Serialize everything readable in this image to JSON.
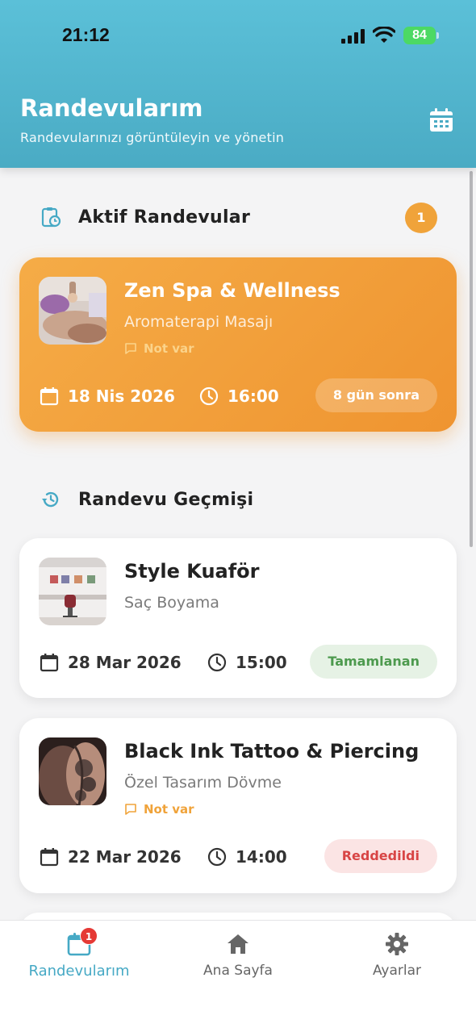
{
  "status_bar": {
    "time": "21:12",
    "battery": "84"
  },
  "header": {
    "title": "Randevularım",
    "subtitle": "Randevularınızı görüntüleyin ve yönetin",
    "calendar_icon": "calendar-icon"
  },
  "active_section": {
    "title": "Aktif Randevular",
    "count": "1",
    "icon": "clipboard-clock-icon",
    "appointments": [
      {
        "business": "Zen Spa & Wellness",
        "service": "Aromaterapi Masajı",
        "note": "Not var",
        "date": "18 Nis 2026",
        "time": "16:00",
        "status": "8 gün sonra"
      }
    ]
  },
  "history_section": {
    "title": "Randevu Geçmişi",
    "icon": "history-icon",
    "appointments": [
      {
        "business": "Style Kuaför",
        "service": "Saç Boyama",
        "date": "28 Mar 2026",
        "time": "15:00",
        "status": "Tamamlanan",
        "status_color": "#4d9a4e"
      },
      {
        "business": "Black Ink Tattoo & Piercing",
        "service": "Özel Tasarım Dövme",
        "note": "Not var",
        "date": "22 Mar 2026",
        "time": "14:00",
        "status": "Reddedildi",
        "status_color": "#d84545"
      }
    ]
  },
  "bottom_nav": {
    "items": [
      {
        "label": "Randevularım",
        "icon": "calendar-icon",
        "badge": "1",
        "active": true
      },
      {
        "label": "Ana Sayfa",
        "icon": "home-icon"
      },
      {
        "label": "Ayarlar",
        "icon": "gear-icon"
      }
    ]
  },
  "colors": {
    "header": "#4aabc4",
    "accent": "#46a9c5",
    "active_card": "#ef9430",
    "badge": "#f0a33a",
    "nav_badge": "#e53935"
  }
}
